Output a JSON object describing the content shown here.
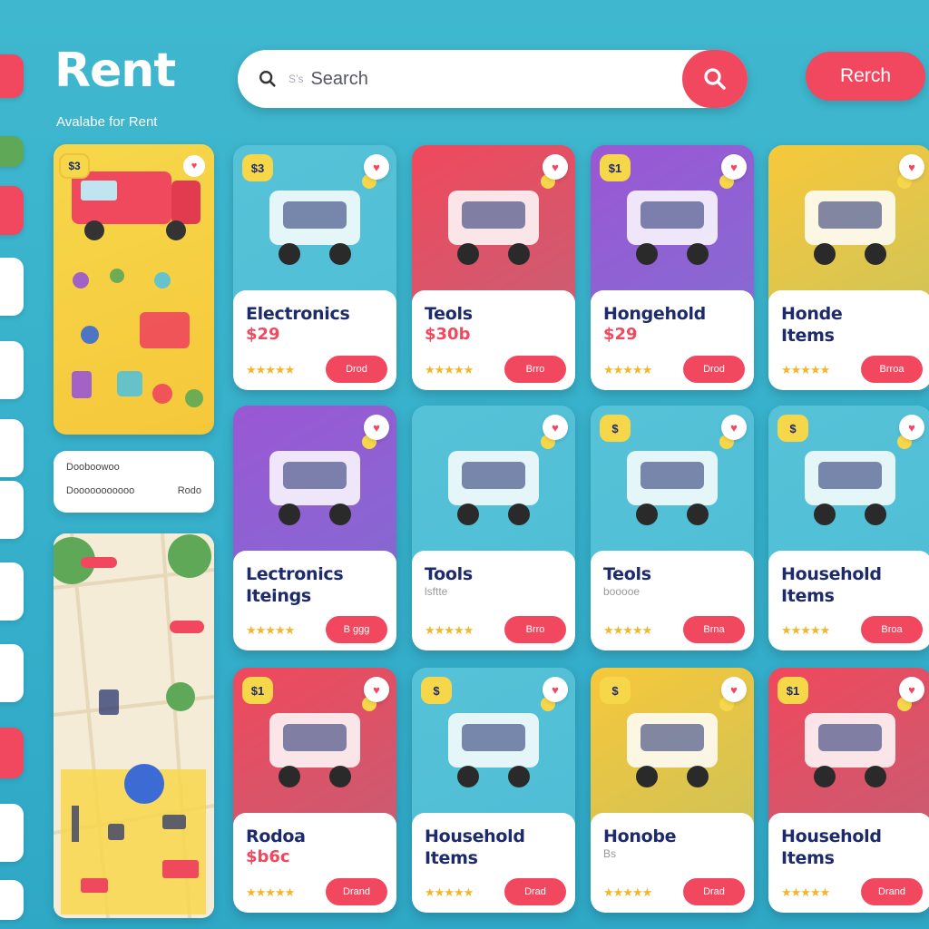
{
  "brand": {
    "logo": "Rent",
    "tagline": "Avalabe for Rent"
  },
  "search": {
    "placeholder": "Search",
    "lead_glyph": "S’s"
  },
  "top_button": {
    "label": "Rerch"
  },
  "filters": {
    "row1_label": "Dooboowoo",
    "row2_label": "Dooooooooooo",
    "row2_value": "Rodo"
  },
  "colors": {
    "accent": "#f1485f",
    "background": "#36b0cb",
    "star": "#f2b72c",
    "navy": "#1d2a6b"
  },
  "cards": [
    {
      "title": "Electronics",
      "price": "$29",
      "badge": "$3",
      "button": "Drod",
      "stars": "★★★★★",
      "art_color": "#56c2d8"
    },
    {
      "title": "Teols",
      "price": "$30b",
      "badge": "",
      "button": "Brro",
      "stars": "★★★★★",
      "art_color": "#f0485c"
    },
    {
      "title": "Hongehold",
      "price": "$29",
      "badge": "$1",
      "button": "Drod",
      "stars": "★★★★★",
      "art_color": "#9a57d4"
    },
    {
      "title": "Honde\nItems",
      "price": "",
      "badge": "",
      "button": "Brroa",
      "stars": "★★★★★",
      "art_color": "#f7c83a"
    },
    {
      "title": "Lectronics\nIteings",
      "price": "",
      "badge": "",
      "button": "B ggg",
      "stars": "★★★★★",
      "art_color": "#9a57d4"
    },
    {
      "title": "Tools",
      "price": "",
      "sub": "lsftte",
      "badge": "",
      "button": "Brro",
      "stars": "★★★★★",
      "art_color": "#56c2d8"
    },
    {
      "title": "Teols",
      "price": "",
      "sub": "booooe",
      "badge": "$",
      "button": "Brna",
      "stars": "★★★★★",
      "art_color": "#56c2d8"
    },
    {
      "title": "Household\nItems",
      "price": "",
      "badge": "$",
      "button": "Broa",
      "stars": "★★★★★",
      "art_color": "#56c2d8"
    },
    {
      "title": "Rodoa",
      "price": "$b6c",
      "badge": "$1",
      "button": "Drand",
      "stars": "★★★★★",
      "art_color": "#f0485c"
    },
    {
      "title": "Household\nItems",
      "price": "",
      "badge": "$",
      "button": "Drad",
      "stars": "★★★★★",
      "art_color": "#56c2d8"
    },
    {
      "title": "Honobe",
      "price": "",
      "sub": "Bs",
      "badge": "$",
      "button": "Drad",
      "stars": "★★★★★",
      "art_color": "#f7c83a"
    },
    {
      "title": "Household\nItems",
      "price": "",
      "badge": "$1",
      "button": "Drand",
      "stars": "★★★★★",
      "art_color": "#f0485c"
    }
  ],
  "left_banner_text": "Rent"
}
